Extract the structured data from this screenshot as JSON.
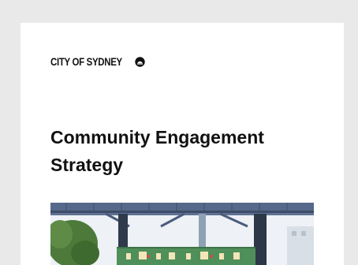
{
  "document": {
    "publisher_logo": "CITY OF SYDNEY",
    "title_line1": "Community Engagement",
    "title_line2": "Strategy"
  },
  "cover_image": {
    "icon": "photo-of-community-street-event"
  },
  "colors": {
    "background": "#e9e9e9",
    "page": "#ffffff",
    "text": "#111111",
    "awning": "#4a5c7c",
    "banner": "#4f8f5a",
    "foliage": "#4d7a3a"
  }
}
